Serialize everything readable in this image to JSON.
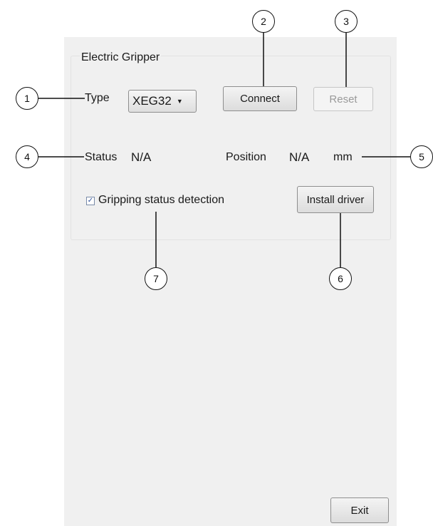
{
  "group": {
    "title": "Electric Gripper"
  },
  "type": {
    "label": "Type",
    "selected": "XEG32"
  },
  "buttons": {
    "connect": "Connect",
    "reset": "Reset",
    "install_driver": "Install driver",
    "exit": "Exit"
  },
  "status": {
    "label": "Status",
    "value": "N/A"
  },
  "position": {
    "label": "Position",
    "value": "N/A",
    "unit": "mm"
  },
  "gripping_detection": {
    "label": "Gripping status detection",
    "checked": true
  },
  "callouts": [
    "1",
    "2",
    "3",
    "4",
    "5",
    "6",
    "7"
  ]
}
